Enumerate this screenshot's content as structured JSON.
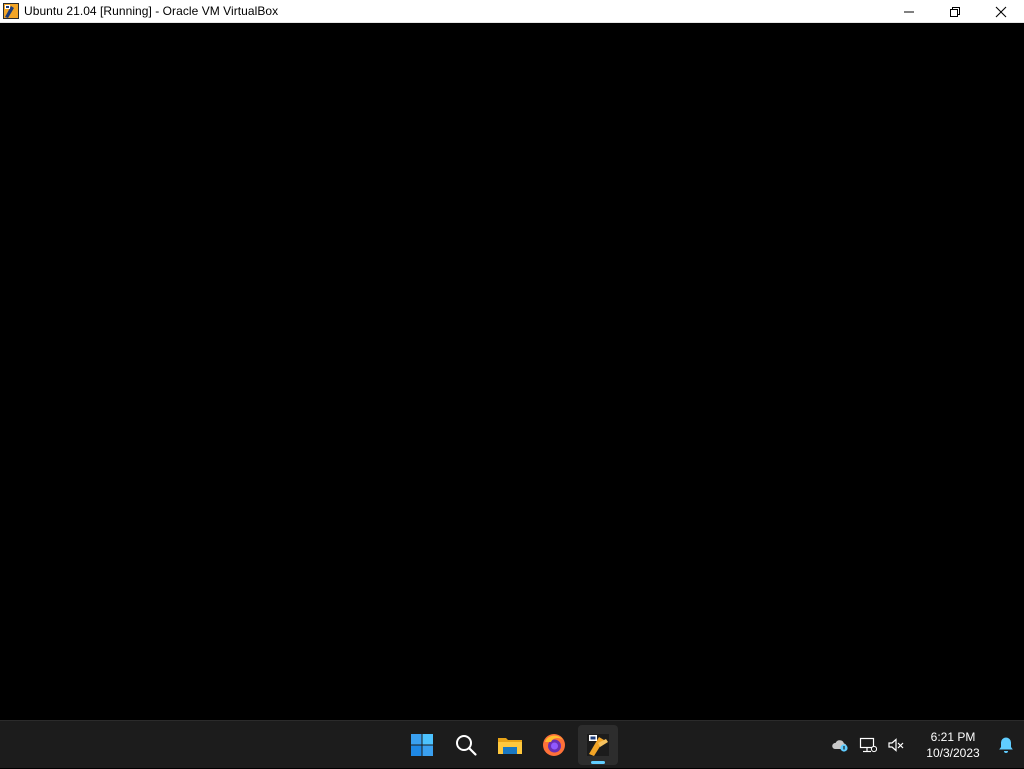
{
  "window": {
    "title": "Ubuntu 21.04 [Running] - Oracle VM VirtualBox",
    "app_icon": "virtualbox-icon",
    "controls": [
      "minimize-icon",
      "restore-icon",
      "close-icon"
    ]
  },
  "vm_screen": {
    "background": "#000000"
  },
  "taskbar": {
    "apps": [
      {
        "name": "start-button",
        "icon": "windows-logo-icon"
      },
      {
        "name": "search-button",
        "icon": "search-icon"
      },
      {
        "name": "file-explorer-button",
        "icon": "folder-icon"
      },
      {
        "name": "firefox-button",
        "icon": "firefox-icon"
      },
      {
        "name": "virtualbox-taskbar-button",
        "icon": "virtualbox-icon",
        "active": true
      }
    ],
    "tray": {
      "icons": [
        "onedrive-cloud-icon",
        "network-icon",
        "volume-muted-icon"
      ],
      "time": "6:21 PM",
      "date": "10/3/2023",
      "notification_icon": "bell-icon"
    },
    "accent": "#60cdff"
  }
}
